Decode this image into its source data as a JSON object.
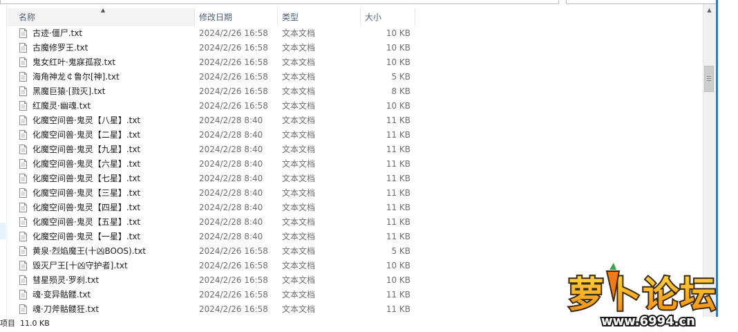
{
  "columns": {
    "name": "名称",
    "date": "修改日期",
    "type": "类型",
    "size": "大小"
  },
  "files": [
    {
      "name": "古迹·僵尸.txt",
      "date": "2024/2/26 16:58",
      "type": "文本文档",
      "size": "10 KB"
    },
    {
      "name": "古魔修罗王.txt",
      "date": "2024/2/26 16:58",
      "type": "文本文档",
      "size": "10 KB"
    },
    {
      "name": "鬼女红叶·鬼寐孤寂.txt",
      "date": "2024/2/26 16:58",
      "type": "文本文档",
      "size": "10 KB"
    },
    {
      "name": "海角神龙￠鲁尔[神].txt",
      "date": "2024/2/26 16:58",
      "type": "文本文档",
      "size": "5 KB"
    },
    {
      "name": "黑魔巨猿·[戮灭].txt",
      "date": "2024/2/26 16:58",
      "type": "文本文档",
      "size": "8 KB"
    },
    {
      "name": "红魔灵·幽魂.txt",
      "date": "2024/2/26 16:58",
      "type": "文本文档",
      "size": "10 KB"
    },
    {
      "name": "化魔空间兽·鬼灵【八星】.txt",
      "date": "2024/2/28 8:40",
      "type": "文本文档",
      "size": "11 KB"
    },
    {
      "name": "化魔空间兽·鬼灵【二星】.txt",
      "date": "2024/2/28 8:40",
      "type": "文本文档",
      "size": "11 KB"
    },
    {
      "name": "化魔空间兽·鬼灵【九星】.txt",
      "date": "2024/2/28 8:40",
      "type": "文本文档",
      "size": "11 KB"
    },
    {
      "name": "化魔空间兽·鬼灵【六星】.txt",
      "date": "2024/2/28 8:40",
      "type": "文本文档",
      "size": "11 KB"
    },
    {
      "name": "化魔空间兽·鬼灵【七星】.txt",
      "date": "2024/2/28 8:40",
      "type": "文本文档",
      "size": "11 KB"
    },
    {
      "name": "化魔空间兽·鬼灵【三星】.txt",
      "date": "2024/2/28 8:40",
      "type": "文本文档",
      "size": "11 KB"
    },
    {
      "name": "化魔空间兽·鬼灵【四星】.txt",
      "date": "2024/2/28 8:40",
      "type": "文本文档",
      "size": "11 KB"
    },
    {
      "name": "化魔空间兽·鬼灵【五星】.txt",
      "date": "2024/2/28 8:40",
      "type": "文本文档",
      "size": "11 KB"
    },
    {
      "name": "化魔空间兽·鬼灵【一星】.txt",
      "date": "2024/2/28 8:40",
      "type": "文本文档",
      "size": "11 KB"
    },
    {
      "name": "黄泉·烈焰魔王(十凶BOOS).txt",
      "date": "2024/2/26 16:58",
      "type": "文本文档",
      "size": "5 KB"
    },
    {
      "name": "毁灭尸王[十凶守护者].txt",
      "date": "2024/2/26 16:58",
      "type": "文本文档",
      "size": "10 KB"
    },
    {
      "name": "彗星殒灵·罗刹.txt",
      "date": "2024/2/26 16:58",
      "type": "文本文档",
      "size": "10 KB"
    },
    {
      "name": "魂·变异骷髅.txt",
      "date": "2024/2/26 16:58",
      "type": "文本文档",
      "size": "11 KB"
    },
    {
      "name": "魂·刀斧骷髅狂.txt",
      "date": "2024/2/26 16:58",
      "type": "文本文档",
      "size": "11 KB"
    }
  ],
  "status": {
    "items_label": "项目",
    "selected_size": "11.0 KB"
  },
  "watermark": {
    "text": "萝卜论坛",
    "url": "www.6994.cn"
  },
  "colors": {
    "header_text": "#4c607a",
    "secondary_text": "#6d6d6d",
    "accent_edge": "#2f79c8",
    "watermark_fill": "#f5a31a"
  }
}
